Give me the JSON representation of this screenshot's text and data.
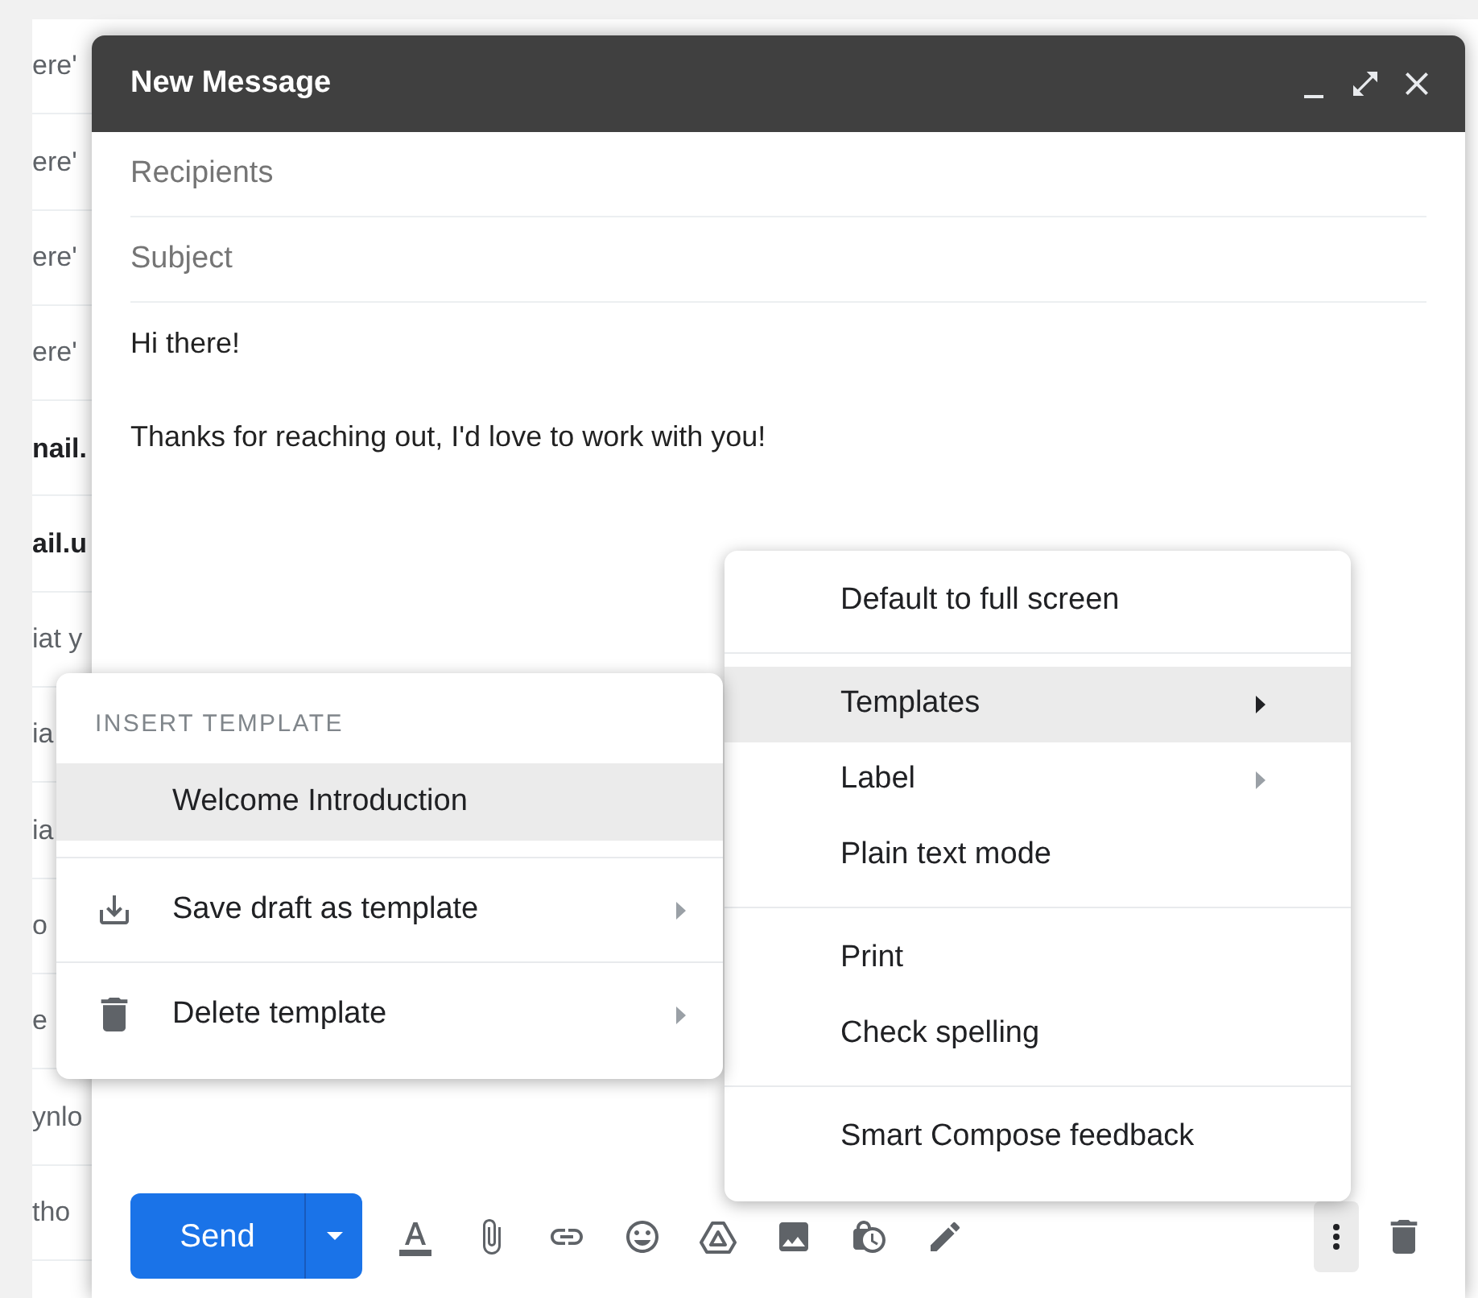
{
  "mail_list": [
    {
      "text": "ere'",
      "unread": false
    },
    {
      "text": "ere'",
      "unread": false
    },
    {
      "text": "ere'",
      "unread": false
    },
    {
      "text": "ere'",
      "unread": false
    },
    {
      "text": "nail.",
      "unread": true
    },
    {
      "text": "ail.u",
      "unread": true
    },
    {
      "text": "iat y",
      "unread": false
    },
    {
      "text": "ia",
      "unread": false
    },
    {
      "text": "ia",
      "unread": false
    },
    {
      "text": "o",
      "unread": false
    },
    {
      "text": "e",
      "unread": false
    },
    {
      "text": "ynlo",
      "unread": false
    },
    {
      "text": "tho",
      "unread": false
    }
  ],
  "compose": {
    "title": "New Message",
    "recipients_placeholder": "Recipients",
    "subject_placeholder": "Subject",
    "body": [
      "Hi there!",
      "Thanks for reaching out, I'd love to work with you!"
    ],
    "send_label": "Send"
  },
  "more_menu": {
    "sections": [
      [
        {
          "label": "Default to full screen",
          "submenu": false,
          "selected": false
        }
      ],
      [
        {
          "label": "Templates",
          "submenu": true,
          "selected": true
        },
        {
          "label": "Label",
          "submenu": true,
          "selected": false
        },
        {
          "label": "Plain text mode",
          "submenu": false,
          "selected": false
        }
      ],
      [
        {
          "label": "Print",
          "submenu": false,
          "selected": false
        },
        {
          "label": "Check spelling",
          "submenu": false,
          "selected": false
        }
      ],
      [
        {
          "label": "Smart Compose feedback",
          "submenu": false,
          "selected": false
        }
      ]
    ]
  },
  "templates_menu": {
    "header": "INSERT TEMPLATE",
    "sections": [
      [
        {
          "label": "Welcome Introduction",
          "submenu": false,
          "selected": true
        }
      ],
      [
        {
          "label": "Save draft as template",
          "submenu": true,
          "selected": false
        }
      ],
      [
        {
          "label": "Delete template",
          "submenu": true,
          "selected": false
        }
      ]
    ]
  }
}
